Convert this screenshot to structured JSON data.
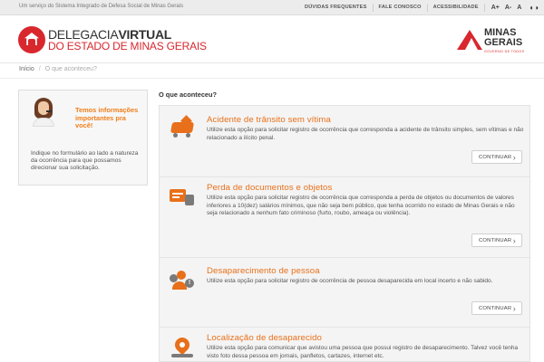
{
  "topbar": {
    "service_text": "Um serviço do Sistema Integrado de Defesa Social de Minas Gerais",
    "links": [
      "DÚVIDAS FREQUENTES",
      "FALE CONOSCO",
      "ACESSIBILIDADE"
    ],
    "font_controls": [
      "A+",
      "A-",
      "A"
    ],
    "contrast_icon": "◐◑"
  },
  "header": {
    "logo_line1_a": "DELEGACIA",
    "logo_line1_b": "VIRTUAL",
    "logo_line2": "DO ESTADO DE MINAS GERAIS",
    "mg_line1": "MINAS",
    "mg_line2": "GERAIS",
    "mg_line3": "GOVERNO DE TODOS"
  },
  "breadcrumb": {
    "home": "Início",
    "separator": "/",
    "current": "O que aconteceu?"
  },
  "sidebar": {
    "title": "Temos informações importantes pra você!",
    "text": "Indique no formulário ao lado a natureza da ocorrência para que possamos direcionar sua solicitação."
  },
  "main": {
    "section_title": "O que aconteceu?",
    "cards": [
      {
        "icon": "car-accident-icon",
        "title": "Acidente de trânsito sem vítima",
        "description": "Utilize esta opção para solicitar registro de ocorrência que corresponda a acidente de trânsito simples, sem vítimas e não relacionado a ilícito penal.",
        "button": "CONTINUAR",
        "chevron": "›"
      },
      {
        "icon": "lost-documents-icon",
        "title": "Perda de documentos e objetos",
        "description": "Utilize esta opção para solicitar registro de ocorrência que corresponda a perda de objetos ou documentos de valores inferiores a 10(dez) salários mínimos, que não seja bem público, que tenha ocorrido no estado de Minas Gerais e não seja relacionado a nenhum fato criminoso (furto, roubo, ameaça ou violência).",
        "button": "CONTINUAR",
        "chevron": "›"
      },
      {
        "icon": "missing-person-icon",
        "title": "Desaparecimento de pessoa",
        "description": "Utilize esta opção para solicitar registro de ocorrência de pessoa desaparecida em local incerto e não sabido.",
        "button": "CONTINUAR",
        "chevron": "›"
      },
      {
        "icon": "location-icon",
        "title": "Localização de desaparecido",
        "description": "Utilize esta opção para comunicar que avistou uma pessoa que possui registro de desaparecimento. Talvez você tenha visto foto dessa pessoa em jornais, panfletos, cartazes, internet etc."
      }
    ]
  },
  "colors": {
    "accent_orange": "#e8701a",
    "brand_red": "#d8272d"
  }
}
